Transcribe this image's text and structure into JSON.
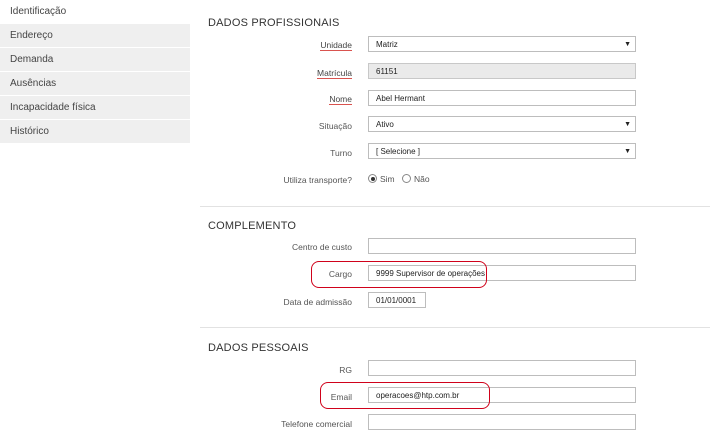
{
  "sidebar": {
    "items": [
      {
        "label": "Identificação"
      },
      {
        "label": "Endereço"
      },
      {
        "label": "Demanda"
      },
      {
        "label": "Ausências"
      },
      {
        "label": "Incapacidade física"
      },
      {
        "label": "Histórico"
      }
    ]
  },
  "profissionais": {
    "title": "DADOS PROFISSIONAIS",
    "unidade_label": "Unidade",
    "unidade_value": "Matriz",
    "matricula_label": "Matrícula",
    "matricula_value": "61151",
    "nome_label": "Nome",
    "nome_value": "Abel Hermant",
    "situacao_label": "Situação",
    "situacao_value": "Ativo",
    "turno_label": "Turno",
    "turno_value": "[ Selecione ]",
    "transporte_label": "Utiliza transporte?",
    "transporte_sim": "Sim",
    "transporte_nao": "Não"
  },
  "complemento": {
    "title": "COMPLEMENTO",
    "centro_label": "Centro de custo",
    "centro_value": "",
    "cargo_label": "Cargo",
    "cargo_value": "9999 Supervisor de operações",
    "admissao_label": "Data de admissão",
    "admissao_value": "01/01/0001"
  },
  "pessoais": {
    "title": "DADOS PESSOAIS",
    "rg_label": "RG",
    "rg_value": "",
    "email_label": "Email",
    "email_value": "operacoes@htp.com.br",
    "telefone_label": "Telefone comercial",
    "telefone_value": ""
  },
  "colors": {
    "highlight": "#d0021b",
    "required_underline": "#d9534f"
  }
}
